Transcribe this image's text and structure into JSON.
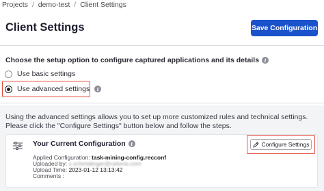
{
  "breadcrumb": {
    "items": [
      "Projects",
      "demo-test",
      "Client Settings"
    ],
    "separator": "/"
  },
  "header": {
    "title": "Client Settings",
    "save_label": "Save Configuration"
  },
  "setup": {
    "question": "Choose the setup option to configure captured applications and its details",
    "options": [
      {
        "label": "Use basic settings",
        "selected": false
      },
      {
        "label": "Use advanced settings",
        "selected": true
      }
    ]
  },
  "advanced": {
    "description": "Using the advanced settings allows you to set up more customized rules and technical settings. Please click the \"Configure Settings\" button below and follow the steps.",
    "card": {
      "title": "Your Current Configuration",
      "applied_label": "Applied Configuration:",
      "applied_value": "task-mining-config.recconf",
      "uploaded_by_label": "Uploaded by:",
      "uploaded_by_value": "s.schmidinger@celonis.com",
      "upload_time_label": "Upload Time:",
      "upload_time_value": "2023-01-12 13:13:42",
      "comments_label": "Comments :",
      "comments_value": "",
      "configure_label": "Configure Settings"
    }
  },
  "colors": {
    "primary": "#1a52cc",
    "highlight": "#e24a3b",
    "panel_bg": "#f3f4f6"
  },
  "icons": {
    "info": "info-icon",
    "sliders": "sliders-icon",
    "pencil": "pencil-icon"
  }
}
